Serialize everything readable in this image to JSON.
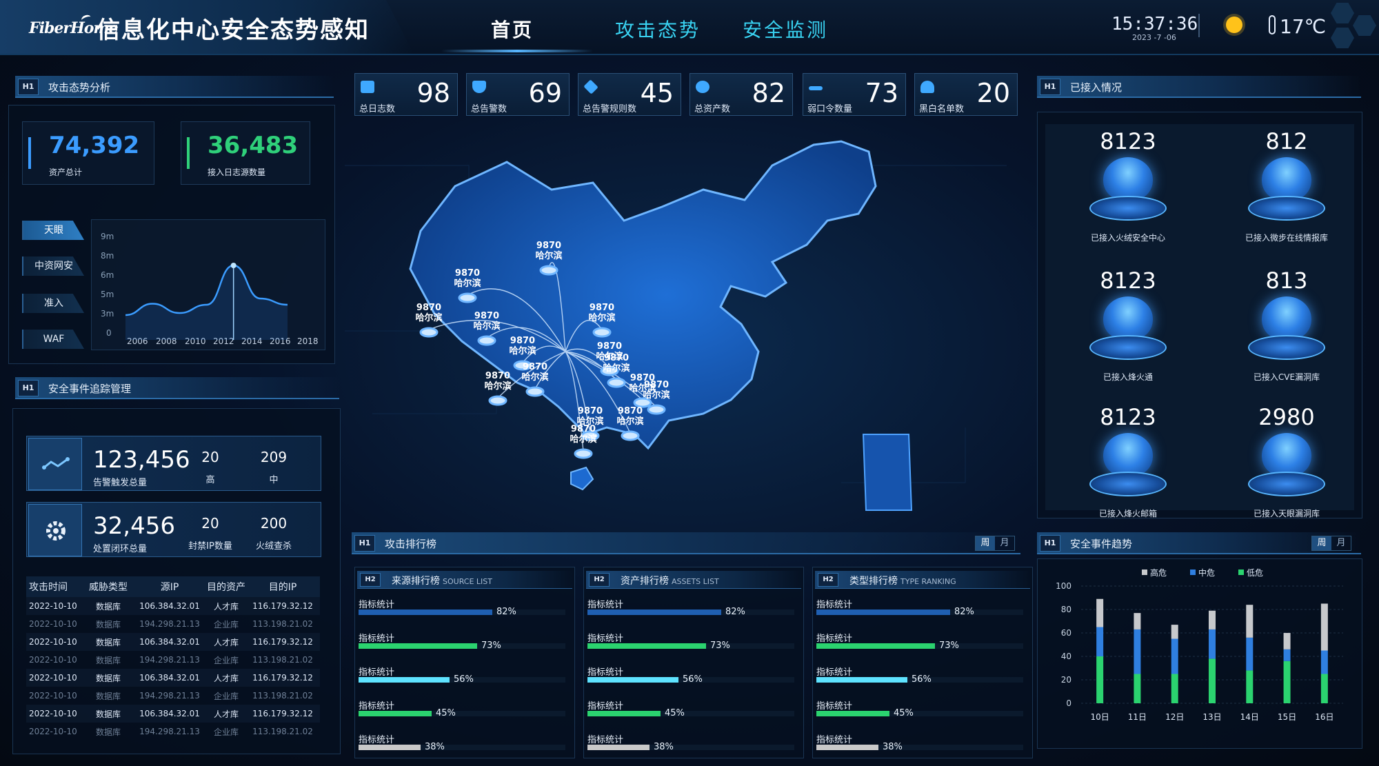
{
  "header": {
    "brand": "FiberHome",
    "title": "信息化中心安全态势感知",
    "nav": [
      {
        "label": "首页",
        "active": true
      },
      {
        "label": "攻击态势",
        "active": false
      },
      {
        "label": "安全监测",
        "active": false
      }
    ],
    "time": "15:37:36",
    "date": "2023 -7 -06",
    "weather_icon": "sun-icon",
    "temperature": "17℃"
  },
  "attack_analysis": {
    "badge": "H1",
    "title": "攻击态势分析",
    "assets_total": {
      "value": "74,392",
      "label": "资产总计",
      "color": "#3b9cff"
    },
    "log_sources": {
      "value": "36,483",
      "label": "接入日志源数量",
      "color": "#2fd07a"
    },
    "tabs": [
      {
        "label": "天眼",
        "active": true
      },
      {
        "label": "中资网安",
        "active": false
      },
      {
        "label": "准入",
        "active": false
      },
      {
        "label": "WAF",
        "active": false
      }
    ],
    "chart_data": {
      "type": "line",
      "x": [
        "2006",
        "2008",
        "2010",
        "2012",
        "2014",
        "2016",
        "2018"
      ],
      "y_ticks": [
        "9m",
        "8m",
        "6m",
        "5m",
        "3m",
        "0"
      ],
      "series": [
        {
          "values": [
            2.4,
            3.5,
            2.6,
            3.4,
            7.2,
            4.0,
            3.4
          ]
        }
      ],
      "highlight_x": "2014"
    }
  },
  "event_tracking": {
    "badge": "H1",
    "title": "安全事件追踪管理",
    "alerts": {
      "total": "123,456",
      "total_label": "告警触发总量",
      "high": "20",
      "high_label": "高",
      "mid": "209",
      "mid_label": "中"
    },
    "closed": {
      "total": "32,456",
      "total_label": "处置闭环总量",
      "blocked": "20",
      "blocked_label": "封禁IP数量",
      "fire": "200",
      "fire_label": "火绒查杀"
    },
    "columns": [
      "攻击时间",
      "威胁类型",
      "源IP",
      "目的资产",
      "目的IP"
    ],
    "rows": [
      [
        "2022-10-10",
        "数据库",
        "106.384.32.01",
        "人才库",
        "116.179.32.12"
      ],
      [
        "2022-10-10",
        "数据库",
        "194.298.21.13",
        "企业库",
        "113.198.21.02"
      ],
      [
        "2022-10-10",
        "数据库",
        "106.384.32.01",
        "人才库",
        "116.179.32.12"
      ],
      [
        "2022-10-10",
        "数据库",
        "194.298.21.13",
        "企业库",
        "113.198.21.02"
      ],
      [
        "2022-10-10",
        "数据库",
        "106.384.32.01",
        "人才库",
        "116.179.32.12"
      ],
      [
        "2022-10-10",
        "数据库",
        "194.298.21.13",
        "企业库",
        "113.198.21.02"
      ],
      [
        "2022-10-10",
        "数据库",
        "106.384.32.01",
        "人才库",
        "116.179.32.12"
      ],
      [
        "2022-10-10",
        "数据库",
        "194.298.21.13",
        "企业库",
        "113.198.21.02"
      ]
    ]
  },
  "kpis": [
    {
      "label": "总日志数",
      "value": "98",
      "icon": "document-icon"
    },
    {
      "label": "总告警数",
      "value": "69",
      "icon": "shield-icon"
    },
    {
      "label": "总告警规则数",
      "value": "45",
      "icon": "rules-icon"
    },
    {
      "label": "总资产数",
      "value": "82",
      "icon": "pie-icon"
    },
    {
      "label": "弱口令数量",
      "value": "73",
      "icon": "password-icon"
    },
    {
      "label": "黑白名单数",
      "value": "20",
      "icon": "user-icon"
    }
  ],
  "map": {
    "markers": [
      {
        "value": "9870",
        "city": "哈尔滨"
      },
      {
        "value": "9870",
        "city": "哈尔滨"
      },
      {
        "value": "9870",
        "city": "哈尔滨"
      },
      {
        "value": "9870",
        "city": "哈尔滨"
      },
      {
        "value": "9870",
        "city": "哈尔滨"
      },
      {
        "value": "9870",
        "city": "哈尔滨"
      },
      {
        "value": "9870",
        "city": "哈尔滨"
      },
      {
        "value": "9870",
        "city": "哈尔滨"
      },
      {
        "value": "9870",
        "city": "哈尔滨"
      },
      {
        "value": "9870",
        "city": "哈尔滨"
      },
      {
        "value": "9870",
        "city": "哈尔滨"
      },
      {
        "value": "9870",
        "city": "哈尔滨"
      },
      {
        "value": "9870",
        "city": "哈尔滨"
      },
      {
        "value": "9870",
        "city": "哈尔滨"
      },
      {
        "value": "9870",
        "city": "哈尔滨"
      }
    ]
  },
  "access": {
    "badge": "H1",
    "title": "已接入情况",
    "items": [
      {
        "value": "8123",
        "label": "已接入火绒安全中心",
        "icon": "shield-icon"
      },
      {
        "value": "812",
        "label": "已接入微步在线情报库",
        "icon": "globe-icon"
      },
      {
        "value": "8123",
        "label": "已接入烽火通",
        "icon": "cube-icon"
      },
      {
        "value": "813",
        "label": "已接入CVE漏洞库",
        "icon": "gear-icon"
      },
      {
        "value": "8123",
        "label": "已接入烽火邮箱",
        "icon": "mail-icon"
      },
      {
        "value": "2980",
        "label": "已接入天眼漏洞库",
        "icon": "eye-icon"
      }
    ]
  },
  "ranking": {
    "badge": "H1",
    "title": "攻击排行榜",
    "toggle": [
      "周",
      "月"
    ],
    "lists": [
      {
        "badge": "H2",
        "title": "来源排行榜",
        "subtitle": "SOURCE LIST"
      },
      {
        "badge": "H2",
        "title": "资产排行榜",
        "subtitle": "ASSETS LIST"
      },
      {
        "badge": "H2",
        "title": "类型排行榜",
        "subtitle": "TYPE RANKING"
      }
    ],
    "rows": [
      {
        "label": "指标统计",
        "value": 82,
        "text": "82%",
        "color": "#1f5fb2"
      },
      {
        "label": "指标统计",
        "value": 73,
        "text": "73%",
        "color": "#2bd36f"
      },
      {
        "label": "指标统计",
        "value": 56,
        "text": "56%",
        "color": "#5ee3ff"
      },
      {
        "label": "指标统计",
        "value": 45,
        "text": "45%",
        "color": "#2bd36f"
      },
      {
        "label": "指标统计",
        "value": 38,
        "text": "38%",
        "color": "#c9c9c9"
      }
    ]
  },
  "trend": {
    "badge": "H1",
    "title": "安全事件趋势",
    "toggle": [
      "周",
      "月"
    ],
    "chart_data": {
      "type": "bar",
      "categories": [
        "10日",
        "11日",
        "12日",
        "13日",
        "14日",
        "15日",
        "16日"
      ],
      "ylim": [
        0,
        100
      ],
      "y_ticks": [
        "100",
        "80",
        "60",
        "40",
        "20",
        "0"
      ],
      "series": [
        {
          "name": "低危",
          "color": "#2bd36f",
          "values": [
            40,
            25,
            25,
            38,
            28,
            36,
            25
          ]
        },
        {
          "name": "中危",
          "color": "#2f7fe0",
          "values": [
            25,
            38,
            30,
            25,
            28,
            10,
            20
          ]
        },
        {
          "name": "高危",
          "color": "#c7c9cc",
          "values": [
            24,
            14,
            12,
            16,
            28,
            14,
            40
          ]
        }
      ]
    }
  }
}
